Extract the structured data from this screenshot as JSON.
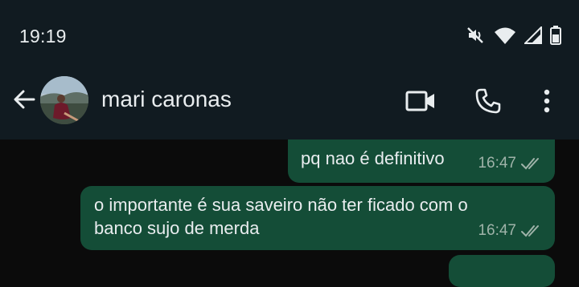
{
  "status_bar": {
    "time": "19:19",
    "icons": [
      "mute-icon",
      "wifi-icon",
      "signal-icon",
      "battery-icon"
    ]
  },
  "header": {
    "back_icon": "arrow-left-icon",
    "contact_name": "mari caronas",
    "actions": [
      "video-call-icon",
      "phone-icon",
      "more-vert-icon"
    ]
  },
  "messages": [
    {
      "text": "pq nao é definitivo",
      "time": "16:47",
      "status": "read",
      "direction": "outgoing"
    },
    {
      "text": "o importante é sua saveiro não ter ficado com o\nbanco sujo de merda",
      "time": "16:47",
      "status": "read",
      "direction": "outgoing"
    }
  ],
  "colors": {
    "header_bg": "#111b21",
    "chat_bg": "#0b0b0b",
    "outgoing_bubble": "#144d37",
    "text": "#e9edef",
    "meta_text": "#9fb3a9"
  }
}
